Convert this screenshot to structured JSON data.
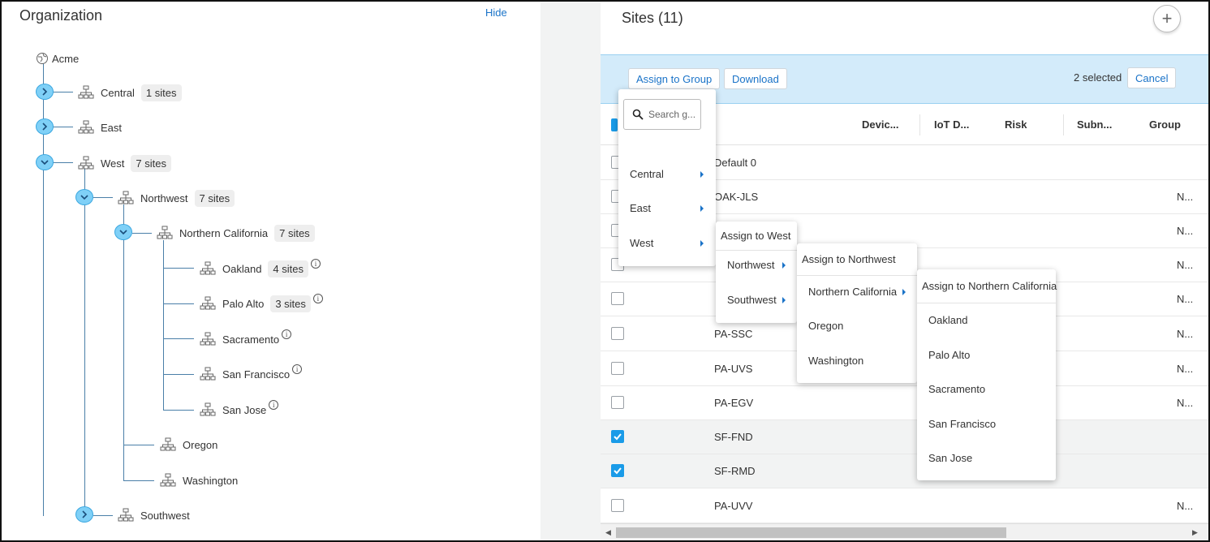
{
  "organization": {
    "title": "Organization",
    "hide_label": "Hide",
    "root": {
      "label": "Acme"
    },
    "nodes": {
      "central": {
        "label": "Central",
        "badge": "1 sites"
      },
      "east": {
        "label": "East"
      },
      "west": {
        "label": "West",
        "badge": "7 sites"
      },
      "northwest": {
        "label": "Northwest",
        "badge": "7 sites"
      },
      "northern_california": {
        "label": "Northern California",
        "badge": "7 sites"
      },
      "oakland": {
        "label": "Oakland",
        "badge": "4 sites"
      },
      "palo_alto": {
        "label": "Palo Alto",
        "badge": "3 sites"
      },
      "sacramento": {
        "label": "Sacramento"
      },
      "san_francisco": {
        "label": "San Francisco"
      },
      "san_jose": {
        "label": "San Jose"
      },
      "oregon": {
        "label": "Oregon"
      },
      "washington": {
        "label": "Washington"
      },
      "southwest": {
        "label": "Southwest"
      }
    },
    "info_glyph": "i"
  },
  "sites": {
    "title": "Sites (11)",
    "add_glyph": "+",
    "toolbar": {
      "assign_label": "Assign to Group",
      "download_label": "Download",
      "selected_text": "2 selected",
      "cancel_label": "Cancel"
    },
    "columns": {
      "devices": "Devic...",
      "iot": "IoT D...",
      "risk": "Risk",
      "subnets": "Subn...",
      "group": "Group"
    },
    "rows": [
      {
        "name": "Default 0",
        "group": "",
        "checked": false
      },
      {
        "name": "OAK-JLS",
        "group": "N...",
        "checked": false
      },
      {
        "name": "",
        "group": "N...",
        "checked": false
      },
      {
        "name": "",
        "group": "N...",
        "checked": false
      },
      {
        "name": "",
        "group": "N...",
        "checked": false
      },
      {
        "name": "PA-SSC",
        "group": "N...",
        "checked": false
      },
      {
        "name": "PA-UVS",
        "group": "N...",
        "checked": false
      },
      {
        "name": "PA-EGV",
        "group": "N...",
        "checked": false
      },
      {
        "name": "SF-FND",
        "group": "",
        "checked": true
      },
      {
        "name": "SF-RMD",
        "group": "",
        "checked": true
      },
      {
        "name": "PA-UVV",
        "group": "N...",
        "checked": false
      }
    ]
  },
  "menus": {
    "group_menu": {
      "search_placeholder": "Search g...",
      "items": [
        "Central",
        "East",
        "West"
      ]
    },
    "west_menu": {
      "header": "Assign to West",
      "items": [
        "Northwest",
        "Southwest"
      ]
    },
    "northwest_menu": {
      "header": "Assign to Northwest",
      "items": [
        "Northern California",
        "Oregon",
        "Washington"
      ]
    },
    "norcal_menu": {
      "header": "Assign to Northern California",
      "items": [
        "Oakland",
        "Palo Alto",
        "Sacramento",
        "San Francisco",
        "San Jose"
      ]
    }
  },
  "colors": {
    "accent": "#1a73c8",
    "bulkbar": "#d3ebfa",
    "toggle": "#7fd0f7",
    "checkbox": "#1a9be8"
  }
}
